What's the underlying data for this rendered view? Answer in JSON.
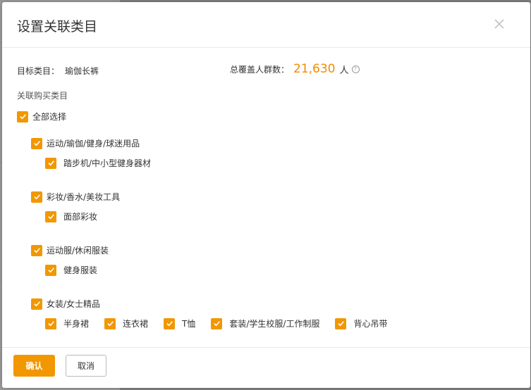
{
  "dialog": {
    "title": "设置关联类目",
    "target_label": "目标类目：",
    "target_value": "瑜伽长裤",
    "coverage_label": "总覆盖人群数：",
    "coverage_value": "21,630",
    "coverage_unit": "人",
    "section_label": "关联购买类目",
    "select_all": "全部选择",
    "groups": [
      {
        "label": "运动/瑜伽/健身/球迷用品",
        "items": [
          "踏步机/中小型健身器材"
        ]
      },
      {
        "label": "彩妆/香水/美妆工具",
        "items": [
          "面部彩妆"
        ]
      },
      {
        "label": "运动服/休闲服装",
        "items": [
          "健身服装"
        ]
      },
      {
        "label": "女装/女士精品",
        "items": [
          "半身裙",
          "连衣裙",
          "T恤",
          "套装/学生校服/工作制服",
          "背心吊带"
        ]
      }
    ],
    "confirm": "确认",
    "cancel": "取消"
  },
  "colors": {
    "accent": "#f29700",
    "number": "#f08c00"
  }
}
